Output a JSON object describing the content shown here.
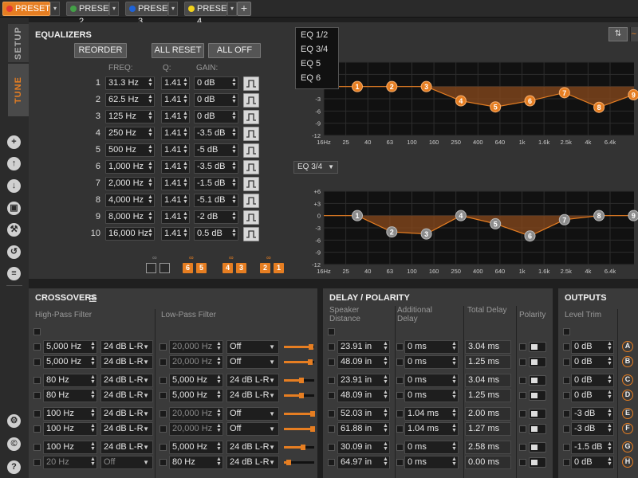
{
  "presets": [
    {
      "label": "PRESET 1",
      "color": "#e53935",
      "active": true
    },
    {
      "label": "PRESET 2",
      "color": "#43a047",
      "active": false
    },
    {
      "label": "PRESET 3",
      "color": "#1e63d8",
      "active": false
    },
    {
      "label": "PRESET 4",
      "color": "#f2d21b",
      "active": false
    }
  ],
  "add_preset_label": "+",
  "tabs": {
    "setup": "SETUP",
    "tune": "TUNE"
  },
  "rail_icons": [
    "add-icon",
    "upload-icon",
    "download-icon",
    "copy-icon",
    "wrench-icon",
    "reset-icon",
    "list-icon",
    "gear-icon",
    "copyright-icon",
    "help-icon"
  ],
  "eq": {
    "title": "EQUALIZERS",
    "reorder": "REORDER",
    "all_reset": "ALL RESET",
    "all_off": "ALL OFF",
    "col_freq": "FREQ:",
    "col_q": "Q:",
    "col_gain": "GAIN:",
    "bands": [
      {
        "n": "1",
        "freq": "31.3 Hz",
        "q": "1.41",
        "gain": "0 dB"
      },
      {
        "n": "2",
        "freq": "62.5 Hz",
        "q": "1.41",
        "gain": "0 dB"
      },
      {
        "n": "3",
        "freq": "125 Hz",
        "q": "1.41",
        "gain": "0 dB"
      },
      {
        "n": "4",
        "freq": "250 Hz",
        "q": "1.41",
        "gain": "-3.5 dB"
      },
      {
        "n": "5",
        "freq": "500 Hz",
        "q": "1.41",
        "gain": "-5 dB"
      },
      {
        "n": "6",
        "freq": "1,000 Hz",
        "q": "1.41",
        "gain": "-3.5 dB"
      },
      {
        "n": "7",
        "freq": "2,000 Hz",
        "q": "1.41",
        "gain": "-1.5 dB"
      },
      {
        "n": "8",
        "freq": "4,000 Hz",
        "q": "1.41",
        "gain": "-5.1 dB"
      },
      {
        "n": "9",
        "freq": "8,000 Hz",
        "q": "1.41",
        "gain": "-2 dB"
      },
      {
        "n": "10",
        "freq": "16,000 Hz",
        "q": "1.41",
        "gain": "0.5 dB"
      }
    ],
    "link_pairs": [
      [
        "",
        ""
      ],
      [
        "6",
        "5"
      ],
      [
        "4",
        "3"
      ],
      [
        "2",
        "1"
      ]
    ]
  },
  "graph_menu": {
    "items": [
      "EQ 1/2",
      "EQ 3/4",
      "EQ 5",
      "EQ 6"
    ]
  },
  "graph2_select": "EQ 3/4",
  "graph": {
    "y_ticks": [
      "+6",
      "+3",
      "0",
      "-3",
      "-6",
      "-9",
      "-12"
    ],
    "x_ticks": [
      "16Hz",
      "25",
      "40",
      "63",
      "100",
      "160",
      "250",
      "400",
      "640",
      "1k",
      "1.6k",
      "2.5k",
      "4k",
      "6.4k"
    ],
    "top_nodes": [
      {
        "label": "1",
        "gain": 0
      },
      {
        "label": "2",
        "gain": 0
      },
      {
        "label": "3",
        "gain": 0
      },
      {
        "label": "4",
        "gain": -3.5
      },
      {
        "label": "5",
        "gain": -5
      },
      {
        "label": "6",
        "gain": -3.5
      },
      {
        "label": "7",
        "gain": -1.5
      },
      {
        "label": "8",
        "gain": -5.1
      },
      {
        "label": "9",
        "gain": -2
      }
    ],
    "bottom_nodes": [
      {
        "label": "1",
        "gain": 0
      },
      {
        "label": "2",
        "gain": -4
      },
      {
        "label": "3",
        "gain": -4.5
      },
      {
        "label": "4",
        "gain": 0
      },
      {
        "label": "5",
        "gain": -2
      },
      {
        "label": "6",
        "gain": -5
      },
      {
        "label": "7",
        "gain": -1
      },
      {
        "label": "8",
        "gain": 0
      },
      {
        "label": "9",
        "gain": 0
      }
    ]
  },
  "crossovers": {
    "title": "CROSSOVERS",
    "hpf_label": "High-Pass Filter",
    "lpf_label": "Low-Pass Filter",
    "rows": [
      {
        "hpf": "5,000 Hz",
        "hslope": "24 dB L-R",
        "lpf": "20,000 Hz",
        "lslope": "Off",
        "lpf_dim": true,
        "level": 0.9
      },
      {
        "hpf": "5,000 Hz",
        "hslope": "24 dB L-R",
        "lpf": "20,000 Hz",
        "lslope": "Off",
        "lpf_dim": true,
        "level": 0.88
      },
      {
        "hpf": "80 Hz",
        "hslope": "24 dB L-R",
        "lpf": "5,000 Hz",
        "lslope": "24 dB L-R",
        "lpf_dim": false,
        "level": 0.58
      },
      {
        "hpf": "80 Hz",
        "hslope": "24 dB L-R",
        "lpf": "5,000 Hz",
        "lslope": "24 dB L-R",
        "lpf_dim": false,
        "level": 0.58
      },
      {
        "hpf": "100 Hz",
        "hslope": "24 dB L-R",
        "lpf": "20,000 Hz",
        "lslope": "Off",
        "lpf_dim": true,
        "level": 0.95
      },
      {
        "hpf": "100 Hz",
        "hslope": "24 dB L-R",
        "lpf": "20,000 Hz",
        "lslope": "Off",
        "lpf_dim": true,
        "level": 0.95
      },
      {
        "hpf": "100 Hz",
        "hslope": "24 dB L-R",
        "lpf": "5,000 Hz",
        "lslope": "24 dB L-R",
        "lpf_dim": false,
        "level": 0.62
      },
      {
        "hpf": "20 Hz",
        "hslope": "Off",
        "lpf": "80 Hz",
        "lslope": "24 dB L-R",
        "lpf_dim": false,
        "hpf_dim": true,
        "level": 0.15
      }
    ]
  },
  "delay": {
    "title": "DELAY / POLARITY",
    "col_speaker": "Speaker Distance",
    "col_additional": "Additional Delay",
    "col_total": "Total Delay",
    "col_polarity": "Polarity",
    "rows": [
      {
        "dist": "23.91 in",
        "add": "0 ms",
        "total": "3.04 ms"
      },
      {
        "dist": "48.09 in",
        "add": "0 ms",
        "total": "1.25 ms"
      },
      {
        "dist": "23.91 in",
        "add": "0 ms",
        "total": "3.04 ms"
      },
      {
        "dist": "48.09 in",
        "add": "0 ms",
        "total": "1.25 ms"
      },
      {
        "dist": "52.03 in",
        "add": "1.04 ms",
        "total": "2.00 ms"
      },
      {
        "dist": "61.88 in",
        "add": "1.04 ms",
        "total": "1.27 ms"
      },
      {
        "dist": "30.09 in",
        "add": "0 ms",
        "total": "2.58 ms"
      },
      {
        "dist": "64.97 in",
        "add": "0 ms",
        "total": "0.00 ms"
      }
    ]
  },
  "outputs": {
    "title": "OUTPUTS",
    "col_trim": "Level Trim",
    "rows": [
      {
        "trim": "0 dB",
        "ch": "A"
      },
      {
        "trim": "0 dB",
        "ch": "B"
      },
      {
        "trim": "0 dB",
        "ch": "C"
      },
      {
        "trim": "0 dB",
        "ch": "D"
      },
      {
        "trim": "-3 dB",
        "ch": "E"
      },
      {
        "trim": "-3 dB",
        "ch": "F"
      },
      {
        "trim": "-1.5 dB",
        "ch": "G"
      },
      {
        "trim": "0 dB",
        "ch": "H"
      }
    ]
  }
}
